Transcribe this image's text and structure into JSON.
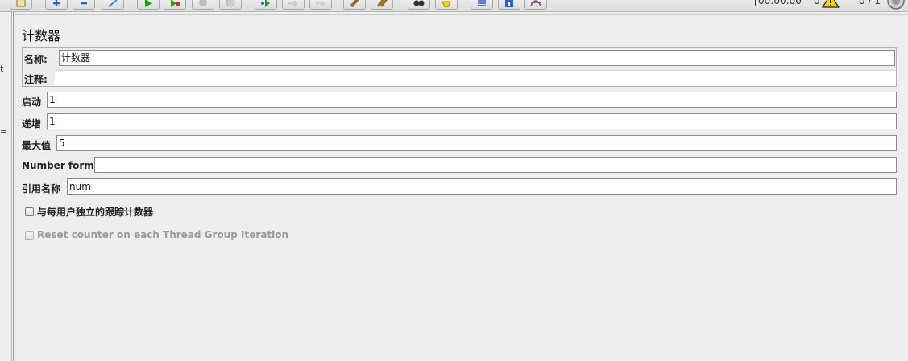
{
  "toolbar": {
    "buttons": [
      {
        "name": "templates-icon"
      },
      {
        "name": "expand-all-icon"
      },
      {
        "name": "collapse-all-icon"
      },
      {
        "name": "toggle-icon"
      },
      {
        "name": "start-icon"
      },
      {
        "name": "start-no-pauses-icon"
      },
      {
        "name": "stop-icon"
      },
      {
        "name": "shutdown-icon"
      },
      {
        "name": "remote-start-icon"
      },
      {
        "name": "remote-stop-icon"
      },
      {
        "name": "remote-shutdown-icon"
      },
      {
        "name": "clear-icon"
      },
      {
        "name": "clear-all-icon"
      },
      {
        "name": "search-icon"
      },
      {
        "name": "reset-search-icon"
      },
      {
        "name": "function-helper-icon"
      },
      {
        "name": "help-icon"
      },
      {
        "name": "log-viewer-icon"
      }
    ],
    "timer": "00:00:00",
    "error_count": "0",
    "thread_count": "0 / 1"
  },
  "left_pane": {
    "fragment_1": "t",
    "fragment_2": "≡"
  },
  "panel": {
    "title": "计数器",
    "name_label": "名称:",
    "name_value": "计数器",
    "comments_label": "注释:",
    "comments_value": "",
    "start_label": "启动",
    "start_value": "1",
    "increment_label": "递增",
    "increment_value": "1",
    "max_label": "最大值",
    "max_value": "5",
    "format_label": "Number format",
    "format_value": "",
    "refname_label": "引用名称",
    "refname_value": "num",
    "per_user_label": "与每用户独立的跟踪计数器",
    "per_user_checked": false,
    "reset_label": "Reset counter on each Thread Group Iteration",
    "reset_checked": false,
    "reset_enabled": false
  },
  "colors": {
    "background": "#eeeeee",
    "field_border": "#8a8a8a",
    "disabled_text": "#9a9a9a",
    "start_green": "#1aa31a",
    "warning_yellow": "#f5d20a"
  }
}
